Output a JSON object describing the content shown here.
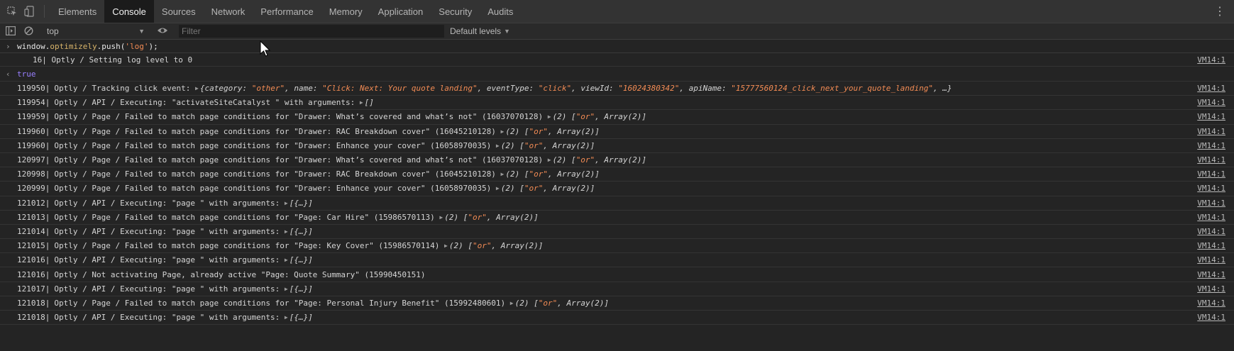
{
  "tabs": [
    "Elements",
    "Console",
    "Sources",
    "Network",
    "Performance",
    "Memory",
    "Application",
    "Security",
    "Audits"
  ],
  "active_tab": "Console",
  "toolbar": {
    "context": "top",
    "filter_placeholder": "Filter",
    "levels": "Default levels"
  },
  "console": {
    "input_command": "window.optimizely.push('log');",
    "first_log": {
      "num": "16|",
      "text": " Optly / Setting log level to 0",
      "src": "VM14:1"
    },
    "result": "true",
    "source_link": "VM14:1",
    "rows": [
      {
        "num": "119950|",
        "pre": "Optly / Tracking click event: ",
        "obj": "{category: \"other\", name: \"Click: Next: Your quote landing\", eventType: \"click\", viewId: \"16024380342\", apiName: \"15777560124_click_next_your_quote_landing\", …}"
      },
      {
        "num": "119954|",
        "pre": "Optly / API / Executing: \"activateSiteCatalyst \" with arguments: ",
        "obj": "[]"
      },
      {
        "num": "119959|",
        "pre": "Optly / Page / Failed to match page conditions for \"Drawer: What’s covered and what’s not\" (16037070128) ",
        "obj": "(2) [\"or\", Array(2)]"
      },
      {
        "num": "119960|",
        "pre": "Optly / Page / Failed to match page conditions for \"Drawer: RAC Breakdown cover\" (16045210128) ",
        "obj": "(2) [\"or\", Array(2)]"
      },
      {
        "num": "119960|",
        "pre": "Optly / Page / Failed to match page conditions for \"Drawer: Enhance your cover\" (16058970035) ",
        "obj": "(2) [\"or\", Array(2)]"
      },
      {
        "num": "120997|",
        "pre": "Optly / Page / Failed to match page conditions for \"Drawer: What’s covered and what’s not\" (16037070128) ",
        "obj": "(2) [\"or\", Array(2)]"
      },
      {
        "num": "120998|",
        "pre": "Optly / Page / Failed to match page conditions for \"Drawer: RAC Breakdown cover\" (16045210128) ",
        "obj": "(2) [\"or\", Array(2)]"
      },
      {
        "num": "120999|",
        "pre": "Optly / Page / Failed to match page conditions for \"Drawer: Enhance your cover\" (16058970035) ",
        "obj": "(2) [\"or\", Array(2)]"
      },
      {
        "num": "121012|",
        "pre": "Optly / API / Executing: \"page \" with arguments: ",
        "obj": "[{…}]"
      },
      {
        "num": "121013|",
        "pre": "Optly / Page / Failed to match page conditions for \"Page: Car Hire\" (15986570113) ",
        "obj": "(2) [\"or\", Array(2)]"
      },
      {
        "num": "121014|",
        "pre": "Optly / API / Executing: \"page \" with arguments: ",
        "obj": "[{…}]"
      },
      {
        "num": "121015|",
        "pre": "Optly / Page / Failed to match page conditions for \"Page: Key Cover\" (15986570114) ",
        "obj": "(2) [\"or\", Array(2)]"
      },
      {
        "num": "121016|",
        "pre": "Optly / API / Executing: \"page \" with arguments: ",
        "obj": "[{…}]"
      },
      {
        "num": "121016|",
        "pre": "Optly / Not activating Page, already active  \"Page: Quote Summary\" (15990450151)",
        "obj": ""
      },
      {
        "num": "121017|",
        "pre": "Optly / API / Executing: \"page \" with arguments: ",
        "obj": "[{…}]"
      },
      {
        "num": "121018|",
        "pre": "Optly / Page / Failed to match page conditions for \"Page: Personal Injury Benefit\" (15992480601) ",
        "obj": "(2) [\"or\", Array(2)]"
      },
      {
        "num": "121018|",
        "pre": "Optly / API / Executing: \"page \" with arguments: ",
        "obj": "[{…}]"
      }
    ]
  }
}
